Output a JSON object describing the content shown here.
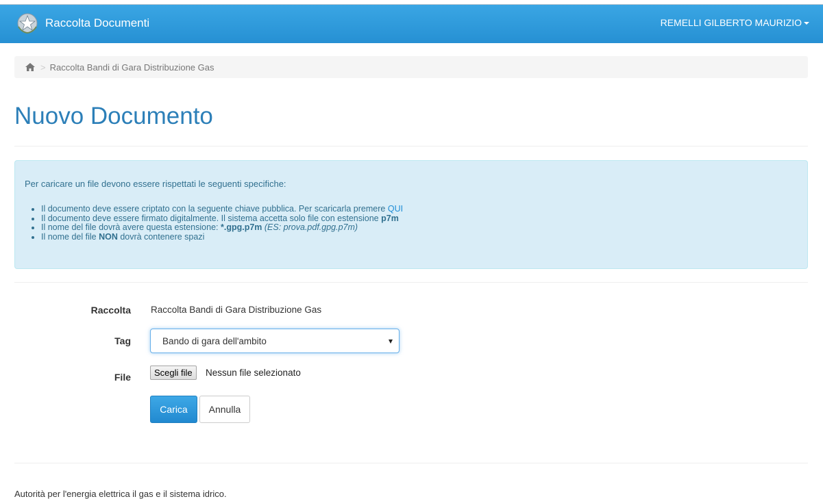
{
  "navbar": {
    "brand_label": "Raccolta Documenti",
    "user_name": "REMELLI GILBERTO MAURIZIO",
    "color": "#2e9ad9"
  },
  "breadcrumb": {
    "current": "Raccolta Bandi di Gara Distribuzione Gas",
    "separator": ">"
  },
  "page": {
    "title": "Nuovo Documento"
  },
  "alert": {
    "intro": "Per caricare un file devono essere rispettati le seguenti specifiche:",
    "item1_text": "Il documento deve essere criptato con la seguente chiave pubblica. Per scaricarla premere",
    "item1_link": "QUI",
    "item2_text": "Il documento deve essere firmato digitalmente. Il sistema accetta solo file con estensione",
    "item2_bold": "p7m",
    "item3_text": "Il nome del file dovrà avere questa estensione:",
    "item3_bold": "*.gpg.p7m",
    "item3_example": "(ES: prova.pdf.gpg.p7m)",
    "item4_pre": "Il nome del file",
    "item4_bold": "NON",
    "item4_post": "dovrà contenere spazi"
  },
  "form": {
    "raccolta_label": "Raccolta",
    "raccolta_value": "Raccolta Bandi di Gara Distribuzione Gas",
    "tag_label": "Tag",
    "tag_selected": "Bando di gara dell'ambito",
    "file_label": "File",
    "file_button": "Scegli file",
    "file_status": "Nessun file selezionato",
    "submit_label": "Carica",
    "cancel_label": "Annulla"
  },
  "footer": {
    "text": "Autorità per l'energia elettrica il gas e il sistema idrico."
  }
}
